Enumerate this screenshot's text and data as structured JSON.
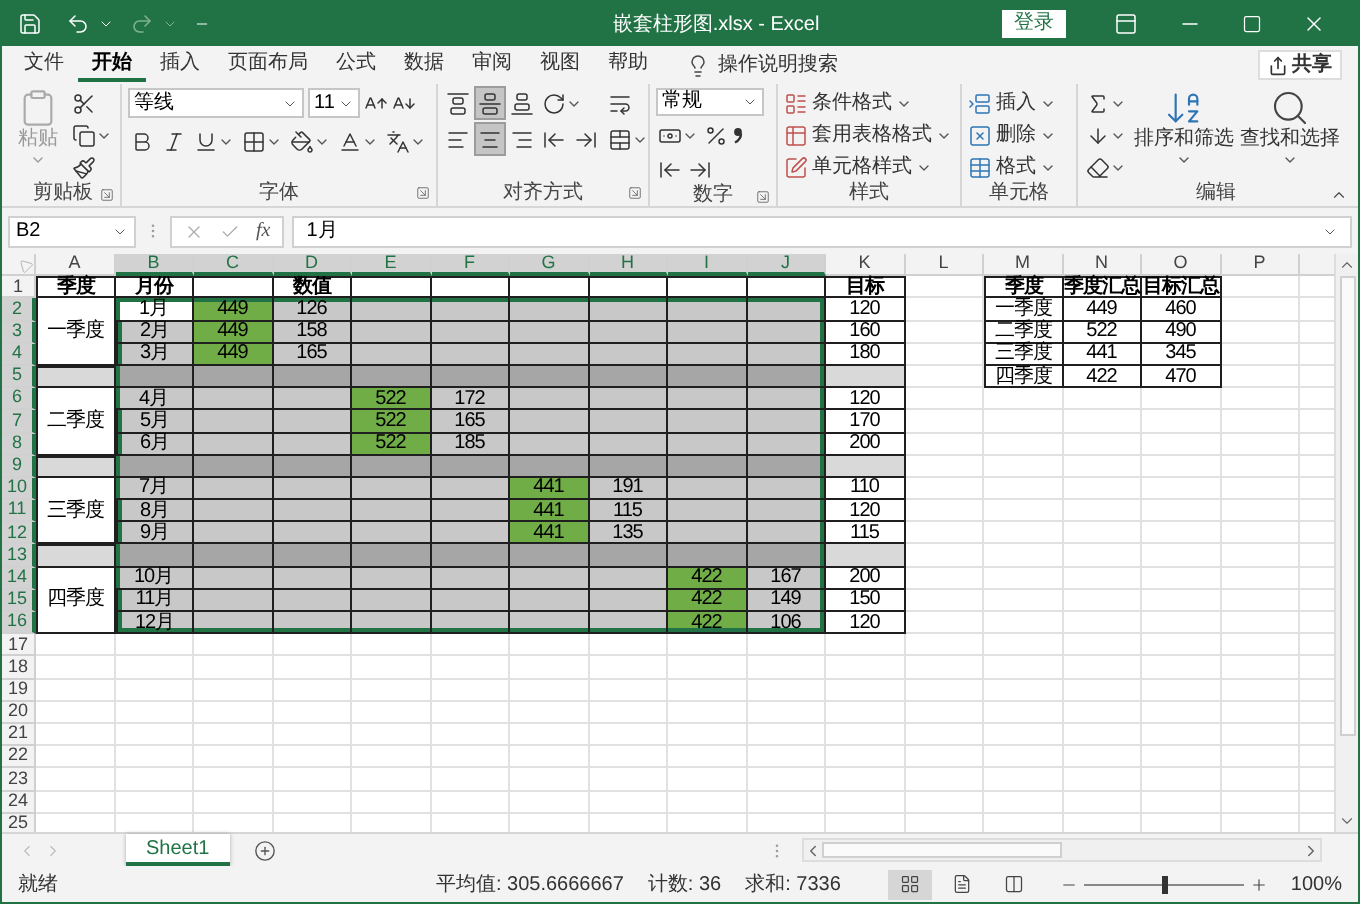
{
  "window": {
    "title": "嵌套柱形图.xlsx - Excel",
    "sign_in": "登录"
  },
  "menu": {
    "tabs": [
      {
        "label": "文件",
        "selected": false
      },
      {
        "label": "开始",
        "selected": true
      },
      {
        "label": "插入",
        "selected": false
      },
      {
        "label": "页面布局",
        "selected": false
      },
      {
        "label": "公式",
        "selected": false
      },
      {
        "label": "数据",
        "selected": false
      },
      {
        "label": "审阅",
        "selected": false
      },
      {
        "label": "视图",
        "selected": false
      },
      {
        "label": "帮助",
        "selected": false
      }
    ],
    "search": "操作说明搜索",
    "share": "共享"
  },
  "ribbon": {
    "clipboard": {
      "label": "剪贴板",
      "paste": "粘贴"
    },
    "font": {
      "label": "字体",
      "font_name": "等线",
      "font_size": "11"
    },
    "alignment": {
      "label": "对齐方式",
      "vertical": [
        {
          "kind": "top",
          "selected": false
        },
        {
          "kind": "middle",
          "selected": true
        },
        {
          "kind": "bottom",
          "selected": false
        }
      ],
      "horizontal": [
        {
          "kind": "left",
          "selected": false
        },
        {
          "kind": "center",
          "selected": true
        },
        {
          "kind": "right",
          "selected": false
        }
      ]
    },
    "number": {
      "label": "数字",
      "format": "常规"
    },
    "styles": {
      "label": "样式",
      "items": [
        {
          "kind": "conditional",
          "label": "条件格式"
        },
        {
          "kind": "table",
          "label": "套用表格格式"
        },
        {
          "kind": "cell",
          "label": "单元格样式"
        }
      ]
    },
    "cells": {
      "label": "单元格",
      "items": [
        {
          "kind": "insert",
          "label": "插入"
        },
        {
          "kind": "delete",
          "label": "删除"
        },
        {
          "kind": "format",
          "label": "格式"
        }
      ]
    },
    "editing": {
      "label": "编辑",
      "sort": "排序和筛选",
      "find": "查找和选择"
    }
  },
  "formula_bar": {
    "name_box": "B2",
    "function_label": "fx",
    "value": "1月"
  },
  "sheet": {
    "columns": [
      {
        "label": "A",
        "selected": false
      },
      {
        "label": "B",
        "selected": true
      },
      {
        "label": "C",
        "selected": true
      },
      {
        "label": "D",
        "selected": true
      },
      {
        "label": "E",
        "selected": true
      },
      {
        "label": "F",
        "selected": true
      },
      {
        "label": "G",
        "selected": true
      },
      {
        "label": "H",
        "selected": true
      },
      {
        "label": "I",
        "selected": true
      },
      {
        "label": "J",
        "selected": true
      },
      {
        "label": "K",
        "selected": false
      },
      {
        "label": "L",
        "selected": false
      },
      {
        "label": "M",
        "selected": false
      },
      {
        "label": "N",
        "selected": false
      },
      {
        "label": "O",
        "selected": false
      },
      {
        "label": "P",
        "selected": false
      }
    ],
    "rows": [
      {
        "number": "1",
        "kind": "header",
        "selected": false,
        "cells": [
          {
            "text": "季度",
            "border": true
          },
          {
            "text": "月份",
            "border": true
          },
          {
            "border": true
          },
          {
            "text": "数值",
            "border": true
          },
          {
            "border": true
          },
          {
            "border": true
          },
          {
            "border": true
          },
          {
            "border": true
          },
          {
            "border": true
          },
          {
            "border": true
          },
          {
            "text": "目标",
            "border": true
          },
          null,
          {
            "text": "季度",
            "border": true
          },
          {
            "text": "季度汇总",
            "border": true
          },
          {
            "text": "目标汇总",
            "border": true
          }
        ]
      },
      {
        "number": "2",
        "kind": "data",
        "selected": true,
        "cells": [
          {
            "text": "一季度",
            "border": true,
            "merged": true
          },
          {
            "text": "1月",
            "border": true,
            "active": true
          },
          {
            "text": "449",
            "border": true,
            "color": "#70ad47"
          },
          {
            "text": "126",
            "border": true
          },
          {
            "border": true
          },
          {
            "border": true
          },
          {
            "border": true
          },
          {
            "border": true
          },
          {
            "border": true
          },
          {
            "border": true
          },
          {
            "text": "120",
            "border": true
          },
          null,
          {
            "text": "一季度",
            "border": true
          },
          {
            "text": "449",
            "border": true
          },
          {
            "text": "460",
            "border": true
          }
        ]
      },
      {
        "number": "3",
        "kind": "data",
        "selected": true,
        "cells": [
          null,
          {
            "text": "2月",
            "border": true
          },
          {
            "text": "449",
            "border": true,
            "color": "#70ad47"
          },
          {
            "text": "158",
            "border": true
          },
          {
            "border": true
          },
          {
            "border": true
          },
          {
            "border": true
          },
          {
            "border": true
          },
          {
            "border": true
          },
          {
            "border": true
          },
          {
            "text": "160",
            "border": true
          },
          null,
          {
            "text": "二季度",
            "border": true
          },
          {
            "text": "522",
            "border": true
          },
          {
            "text": "490",
            "border": true
          }
        ]
      },
      {
        "number": "4",
        "kind": "data",
        "selected": true,
        "cells": [
          null,
          {
            "text": "3月",
            "border": true
          },
          {
            "text": "449",
            "border": true,
            "color": "#70ad47"
          },
          {
            "text": "165",
            "border": true
          },
          {
            "border": true
          },
          {
            "border": true
          },
          {
            "border": true
          },
          {
            "border": true
          },
          {
            "border": true
          },
          {
            "border": true
          },
          {
            "text": "180",
            "border": true
          },
          null,
          {
            "text": "三季度",
            "border": true
          },
          {
            "text": "441",
            "border": true
          },
          {
            "text": "345",
            "border": true
          }
        ]
      },
      {
        "number": "5",
        "kind": "separator",
        "selected": true,
        "cells": [
          {
            "border": true,
            "color": "#d9d9d9"
          },
          {
            "border": true,
            "color": "#a6a6a6"
          },
          {
            "border": true,
            "color": "#a6a6a6"
          },
          {
            "border": true,
            "color": "#a6a6a6"
          },
          {
            "border": true,
            "color": "#a6a6a6"
          },
          {
            "border": true,
            "color": "#a6a6a6"
          },
          {
            "border": true,
            "color": "#a6a6a6"
          },
          {
            "border": true,
            "color": "#a6a6a6"
          },
          {
            "border": true,
            "color": "#a6a6a6"
          },
          {
            "border": true,
            "color": "#a6a6a6"
          },
          {
            "border": true,
            "color": "#d9d9d9"
          },
          null,
          {
            "text": "四季度",
            "border": true
          },
          {
            "text": "422",
            "border": true
          },
          {
            "text": "470",
            "border": true
          }
        ]
      },
      {
        "number": "6",
        "kind": "data",
        "selected": true,
        "cells": [
          {
            "text": "二季度",
            "border": true,
            "merged": true
          },
          {
            "text": "4月",
            "border": true
          },
          {
            "border": true
          },
          {
            "border": true
          },
          {
            "text": "522",
            "border": true,
            "color": "#70ad47"
          },
          {
            "text": "172",
            "border": true
          },
          {
            "border": true
          },
          {
            "border": true
          },
          {
            "border": true
          },
          {
            "border": true
          },
          {
            "text": "120",
            "border": true
          }
        ]
      },
      {
        "number": "7",
        "kind": "data",
        "selected": true,
        "cells": [
          null,
          {
            "text": "5月",
            "border": true
          },
          {
            "border": true
          },
          {
            "border": true
          },
          {
            "text": "522",
            "border": true,
            "color": "#70ad47"
          },
          {
            "text": "165",
            "border": true
          },
          {
            "border": true
          },
          {
            "border": true
          },
          {
            "border": true
          },
          {
            "border": true
          },
          {
            "text": "170",
            "border": true
          }
        ]
      },
      {
        "number": "8",
        "kind": "data",
        "selected": true,
        "cells": [
          null,
          {
            "text": "6月",
            "border": true
          },
          {
            "border": true
          },
          {
            "border": true
          },
          {
            "text": "522",
            "border": true,
            "color": "#70ad47"
          },
          {
            "text": "185",
            "border": true
          },
          {
            "border": true
          },
          {
            "border": true
          },
          {
            "border": true
          },
          {
            "border": true
          },
          {
            "text": "200",
            "border": true
          }
        ]
      },
      {
        "number": "9",
        "kind": "separator",
        "selected": true,
        "cells": [
          {
            "border": true,
            "color": "#d9d9d9"
          },
          {
            "border": true,
            "color": "#a6a6a6"
          },
          {
            "border": true,
            "color": "#a6a6a6"
          },
          {
            "border": true,
            "color": "#a6a6a6"
          },
          {
            "border": true,
            "color": "#a6a6a6"
          },
          {
            "border": true,
            "color": "#a6a6a6"
          },
          {
            "border": true,
            "color": "#a6a6a6"
          },
          {
            "border": true,
            "color": "#a6a6a6"
          },
          {
            "border": true,
            "color": "#a6a6a6"
          },
          {
            "border": true,
            "color": "#a6a6a6"
          },
          {
            "border": true,
            "color": "#d9d9d9"
          }
        ]
      },
      {
        "number": "10",
        "kind": "data",
        "selected": true,
        "cells": [
          {
            "text": "三季度",
            "border": true,
            "merged": true
          },
          {
            "text": "7月",
            "border": true
          },
          {
            "border": true
          },
          {
            "border": true
          },
          {
            "border": true
          },
          {
            "border": true
          },
          {
            "text": "441",
            "border": true,
            "color": "#70ad47"
          },
          {
            "text": "191",
            "border": true
          },
          {
            "border": true
          },
          {
            "border": true
          },
          {
            "text": "110",
            "border": true
          }
        ]
      },
      {
        "number": "11",
        "kind": "data",
        "selected": true,
        "cells": [
          null,
          {
            "text": "8月",
            "border": true
          },
          {
            "border": true
          },
          {
            "border": true
          },
          {
            "border": true
          },
          {
            "border": true
          },
          {
            "text": "441",
            "border": true,
            "color": "#70ad47"
          },
          {
            "text": "115",
            "border": true
          },
          {
            "border": true
          },
          {
            "border": true
          },
          {
            "text": "120",
            "border": true
          }
        ]
      },
      {
        "number": "12",
        "kind": "data",
        "selected": true,
        "cells": [
          null,
          {
            "text": "9月",
            "border": true
          },
          {
            "border": true
          },
          {
            "border": true
          },
          {
            "border": true
          },
          {
            "border": true
          },
          {
            "text": "441",
            "border": true,
            "color": "#70ad47"
          },
          {
            "text": "135",
            "border": true
          },
          {
            "border": true
          },
          {
            "border": true
          },
          {
            "text": "115",
            "border": true
          }
        ]
      },
      {
        "number": "13",
        "kind": "separator",
        "selected": true,
        "cells": [
          {
            "border": true,
            "color": "#d9d9d9"
          },
          {
            "border": true,
            "color": "#a6a6a6"
          },
          {
            "border": true,
            "color": "#a6a6a6"
          },
          {
            "border": true,
            "color": "#a6a6a6"
          },
          {
            "border": true,
            "color": "#a6a6a6"
          },
          {
            "border": true,
            "color": "#a6a6a6"
          },
          {
            "border": true,
            "color": "#a6a6a6"
          },
          {
            "border": true,
            "color": "#a6a6a6"
          },
          {
            "border": true,
            "color": "#a6a6a6"
          },
          {
            "border": true,
            "color": "#a6a6a6"
          },
          {
            "border": true,
            "color": "#d9d9d9"
          }
        ]
      },
      {
        "number": "14",
        "kind": "data",
        "selected": true,
        "cells": [
          {
            "text": "四季度",
            "border": true,
            "merged": true
          },
          {
            "text": "10月",
            "border": true
          },
          {
            "border": true
          },
          {
            "border": true
          },
          {
            "border": true
          },
          {
            "border": true
          },
          {
            "border": true
          },
          {
            "border": true
          },
          {
            "text": "422",
            "border": true,
            "color": "#70ad47"
          },
          {
            "text": "167",
            "border": true
          },
          {
            "text": "200",
            "border": true
          }
        ]
      },
      {
        "number": "15",
        "kind": "data",
        "selected": true,
        "cells": [
          null,
          {
            "text": "11月",
            "border": true
          },
          {
            "border": true
          },
          {
            "border": true
          },
          {
            "border": true
          },
          {
            "border": true
          },
          {
            "border": true
          },
          {
            "border": true
          },
          {
            "text": "422",
            "border": true,
            "color": "#70ad47"
          },
          {
            "text": "149",
            "border": true
          },
          {
            "text": "150",
            "border": true
          }
        ]
      },
      {
        "number": "16",
        "kind": "data",
        "selected": true,
        "cells": [
          null,
          {
            "text": "12月",
            "border": true
          },
          {
            "border": true
          },
          {
            "border": true
          },
          {
            "border": true
          },
          {
            "border": true
          },
          {
            "border": true
          },
          {
            "border": true
          },
          {
            "text": "422",
            "border": true,
            "color": "#70ad47"
          },
          {
            "text": "106",
            "border": true
          },
          {
            "text": "120",
            "border": true
          }
        ]
      },
      {
        "number": "17",
        "kind": "blank",
        "selected": false
      },
      {
        "number": "18",
        "kind": "blank",
        "selected": false
      },
      {
        "number": "19",
        "kind": "blank",
        "selected": false
      },
      {
        "number": "20",
        "kind": "blank",
        "selected": false
      },
      {
        "number": "21",
        "kind": "blank",
        "selected": false
      },
      {
        "number": "22",
        "kind": "blank",
        "selected": false
      },
      {
        "number": "23",
        "kind": "blank",
        "selected": false
      },
      {
        "number": "24",
        "kind": "blank",
        "selected": false
      },
      {
        "number": "25",
        "kind": "blank",
        "selected": false
      }
    ]
  },
  "sheet_tabs": [
    {
      "label": "Sheet1",
      "selected": true
    }
  ],
  "status_bar": {
    "status": "就绪",
    "stats": [
      "平均值: 305.6666667",
      "计数: 36",
      "求和: 7336"
    ],
    "views": [
      {
        "kind": "normal",
        "selected": true
      },
      {
        "kind": "page_layout",
        "selected": false
      },
      {
        "kind": "page_break",
        "selected": false
      }
    ],
    "zoom": {
      "level": 0.5,
      "reading": "100%"
    }
  }
}
